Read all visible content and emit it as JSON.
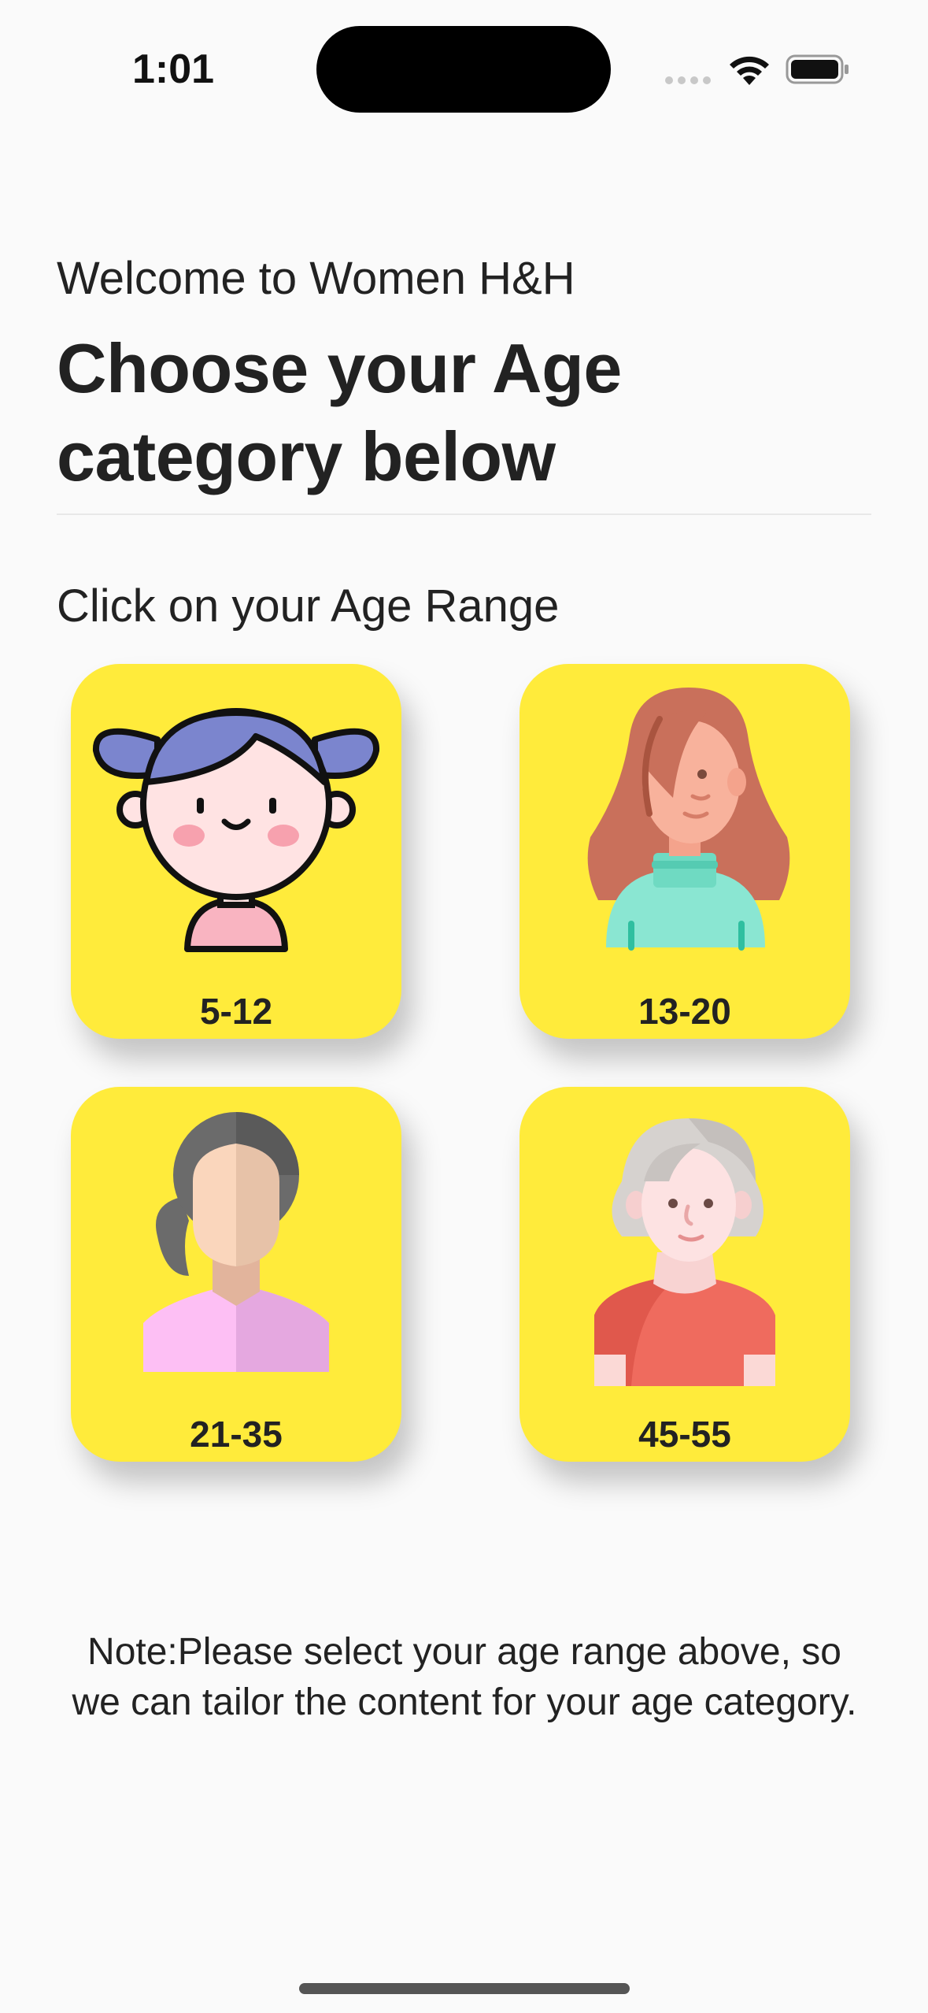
{
  "status_bar": {
    "time": "1:01"
  },
  "header": {
    "welcome": "Welcome to Women H&H",
    "title": "Choose your Age category below"
  },
  "section": {
    "label": "Click on your Age Range"
  },
  "age_cards": [
    {
      "label": "5-12",
      "icon": "girl-avatar-icon"
    },
    {
      "label": "13-20",
      "icon": "teen-avatar-icon"
    },
    {
      "label": "21-35",
      "icon": "woman-avatar-icon"
    },
    {
      "label": "45-55",
      "icon": "mature-woman-avatar-icon"
    }
  ],
  "note": "Note:Please select your age range above, so we can tailor the content for your age category.",
  "colors": {
    "card_background": "#FFEB3B",
    "page_background": "#FAFAFA",
    "text": "#222222"
  }
}
